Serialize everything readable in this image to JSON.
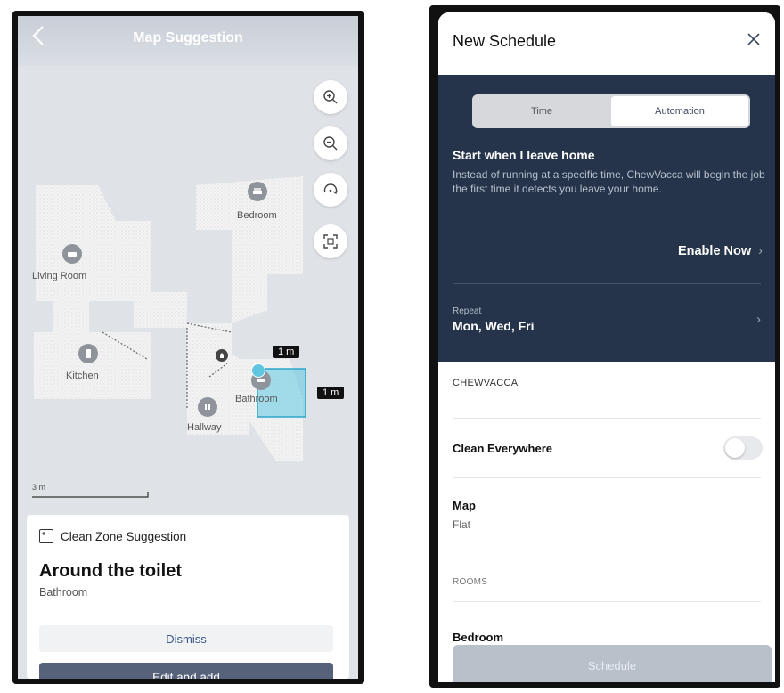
{
  "left_screen": {
    "header": {
      "title": "Map Suggestion"
    },
    "map": {
      "rooms": {
        "bedroom": "Bedroom",
        "living_room": "Living Room",
        "kitchen": "Kitchen",
        "bathroom": "Bathroom",
        "hallway": "Hallway"
      },
      "scale": "3 m",
      "zone_width": "1 m",
      "zone_height": "1 m"
    },
    "card": {
      "heading": "Clean Zone Suggestion",
      "title": "Around the toilet",
      "subtitle": "Bathroom",
      "dismiss_label": "Dismiss",
      "edit_label": "Edit and add"
    }
  },
  "right_screen": {
    "header": {
      "title": "New Schedule"
    },
    "tabs": {
      "time": "Time",
      "automation": "Automation",
      "selected": "Automation"
    },
    "automation": {
      "title": "Start when I leave home",
      "description": "Instead of running at a specific time, ChewVacca will begin the job the first time it detects you leave your home.",
      "enable_label": "Enable Now"
    },
    "repeat": {
      "label": "Repeat",
      "value": "Mon, Wed, Fri"
    },
    "device_section": "CHEWVACCA",
    "clean_everywhere": {
      "label": "Clean Everywhere",
      "enabled": false
    },
    "map": {
      "label": "Map",
      "value": "Flat"
    },
    "rooms_section": "ROOMS",
    "first_room": "Bedroom",
    "schedule_label": "Schedule"
  },
  "colors": {
    "dark_panel": "#25344a",
    "primary_button": "#55627a",
    "zone_highlight": "#5fc6e0",
    "disabled_button": "#b8c0ca"
  }
}
